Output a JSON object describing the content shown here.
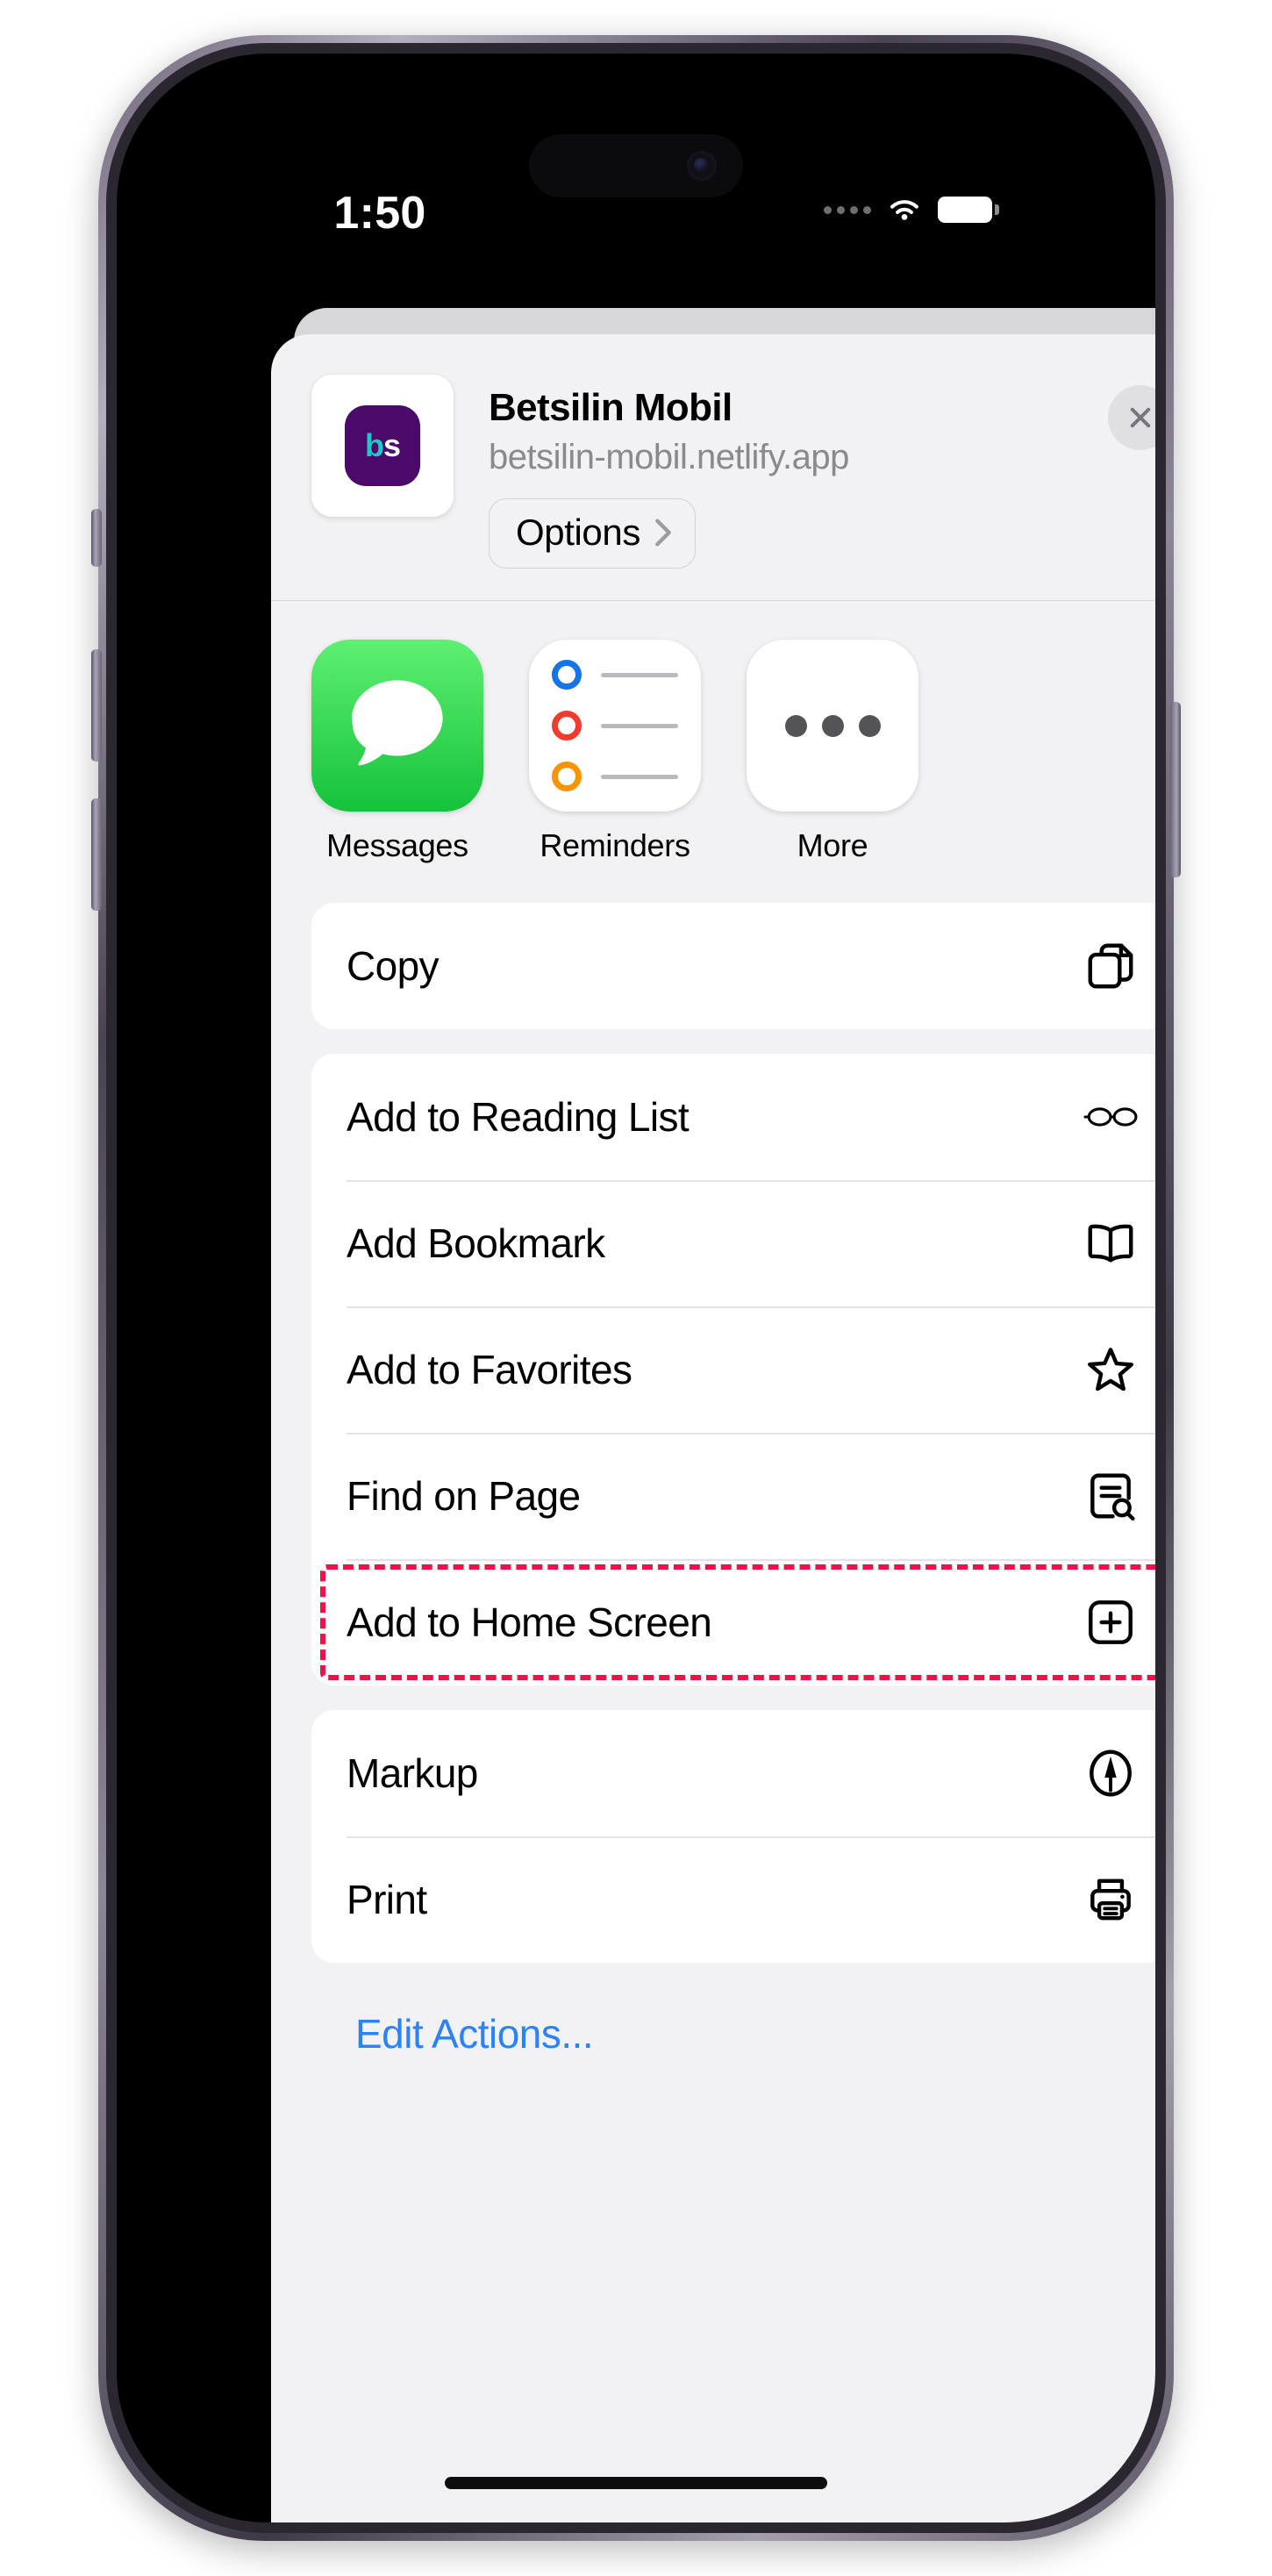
{
  "status_bar": {
    "time": "1:50",
    "signal_icon": "cellular-dots-icon",
    "wifi_icon": "wifi-icon",
    "battery_icon": "battery-full-icon"
  },
  "share_sheet": {
    "app_icon_text_primary": "b",
    "app_icon_text_secondary": "s",
    "title": "Betsilin Mobil",
    "url": "betsilin-mobil.netlify.app",
    "options_label": "Options",
    "close_label": "Close",
    "apps": [
      {
        "name": "Messages",
        "icon": "messages-icon"
      },
      {
        "name": "Reminders",
        "icon": "reminders-icon"
      },
      {
        "name": "More",
        "icon": "more-ellipsis-icon"
      }
    ],
    "groups": [
      {
        "id": "copy-group",
        "rows": [
          {
            "label": "Copy",
            "icon": "copy-documents-icon",
            "highlighted": false
          }
        ]
      },
      {
        "id": "browser-actions-group",
        "rows": [
          {
            "label": "Add to Reading List",
            "icon": "glasses-icon",
            "highlighted": false
          },
          {
            "label": "Add Bookmark",
            "icon": "open-book-icon",
            "highlighted": false
          },
          {
            "label": "Add to Favorites",
            "icon": "star-icon",
            "highlighted": false
          },
          {
            "label": "Find on Page",
            "icon": "document-search-icon",
            "highlighted": false
          },
          {
            "label": "Add to Home Screen",
            "icon": "plus-square-icon",
            "highlighted": true
          }
        ]
      },
      {
        "id": "tools-group",
        "rows": [
          {
            "label": "Markup",
            "icon": "markup-pen-icon",
            "highlighted": false
          },
          {
            "label": "Print",
            "icon": "printer-icon",
            "highlighted": false
          }
        ]
      }
    ],
    "edit_actions_label": "Edit Actions...",
    "highlight_color": "#f0114a",
    "link_color": "#2b82ff"
  }
}
